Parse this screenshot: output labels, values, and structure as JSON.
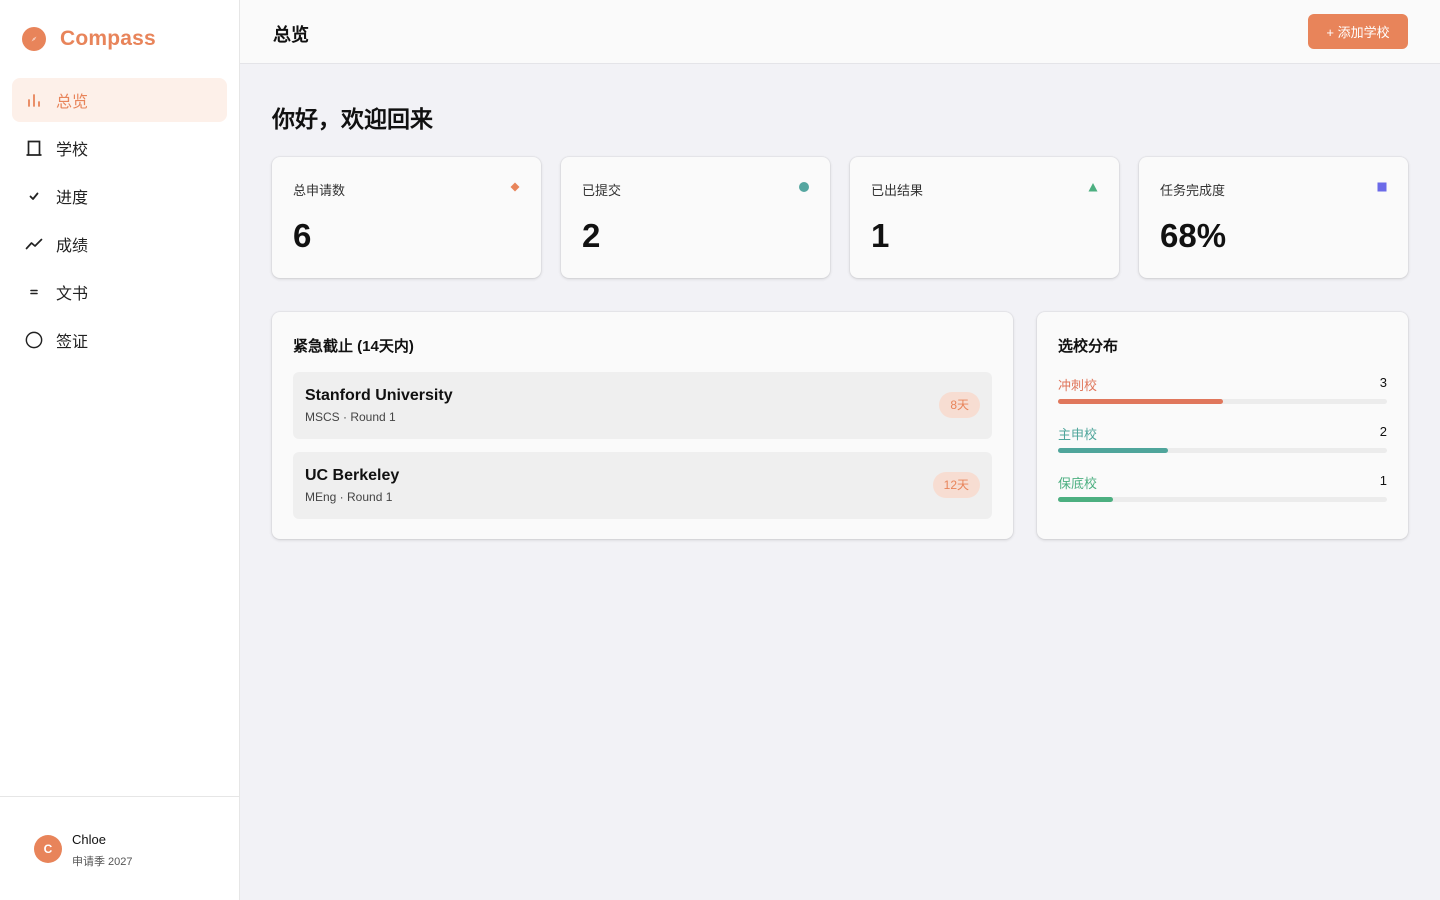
{
  "app": {
    "name": "Compass"
  },
  "sidebar": {
    "items": [
      {
        "label": "总览",
        "icon": "bar-chart-icon",
        "active": true
      },
      {
        "label": "学校",
        "icon": "building-icon",
        "active": false
      },
      {
        "label": "进度",
        "icon": "check-icon",
        "active": false
      },
      {
        "label": "成绩",
        "icon": "trend-up-icon",
        "active": false
      },
      {
        "label": "文书",
        "icon": "document-lines-icon",
        "active": false
      },
      {
        "label": "签证",
        "icon": "circle-icon",
        "active": false
      }
    ],
    "user": {
      "initial": "C",
      "name": "Chloe",
      "subtitle": "申请季 2027"
    }
  },
  "header": {
    "title": "总览",
    "add_button_label": "+ 添加学校"
  },
  "main": {
    "greeting": "你好，欢迎回来",
    "stats": [
      {
        "label": "总申请数",
        "value": "6",
        "marker": "diamond-icon",
        "color": "#e8845a"
      },
      {
        "label": "已提交",
        "value": "2",
        "marker": "dot-icon",
        "color": "#55a6a0"
      },
      {
        "label": "已出结果",
        "value": "1",
        "marker": "triangle-icon",
        "color": "#4caf80"
      },
      {
        "label": "任务完成度",
        "value": "68%",
        "marker": "square-icon",
        "color": "#6b6ae8"
      }
    ],
    "deadlines": {
      "title": "紧急截止 (14天内)",
      "items": [
        {
          "school": "Stanford University",
          "detail": "MSCS · Round 1",
          "badge": "8天"
        },
        {
          "school": "UC Berkeley",
          "detail": "MEng · Round 1",
          "badge": "12天"
        }
      ]
    },
    "distribution": {
      "title": "选校分布",
      "items": [
        {
          "label": "冲刺校",
          "count": "3",
          "fraction": 0.5,
          "color": "#e0775c"
        },
        {
          "label": "主申校",
          "count": "2",
          "fraction": 0.333,
          "color": "#4fa59b"
        },
        {
          "label": "保底校",
          "count": "1",
          "fraction": 0.167,
          "color": "#4caf80"
        }
      ]
    }
  }
}
